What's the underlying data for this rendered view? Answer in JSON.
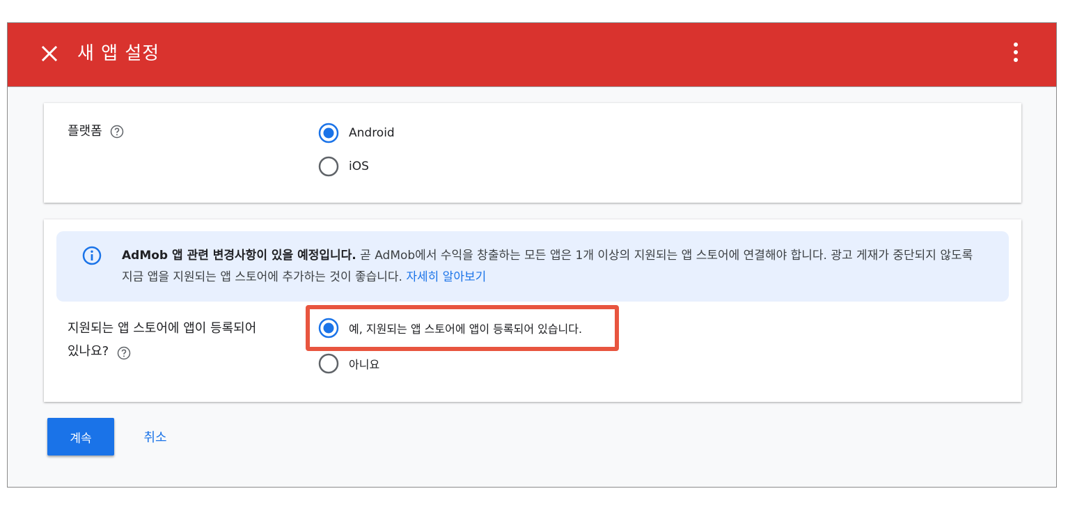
{
  "header": {
    "title": "새 앱 설정",
    "close_icon": "close-icon",
    "more_icon": "more-vert-icon"
  },
  "platform": {
    "label": "플랫폼",
    "options": [
      "Android",
      "iOS"
    ],
    "selected": "Android"
  },
  "notice": {
    "bold": "AdMob 앱 관련 변경사항이 있을 예정입니다.",
    "text": " 곧 AdMob에서 수익을 창출하는 모든 앱은 1개 이상의 지원되는 앱 스토어에 연결해야 합니다. 광고 게재가 중단되지 않도록 지금 앱을 지원되는 앱 스토어에 추가하는 것이 좋습니다. ",
    "link": "자세히 알아보기"
  },
  "store_question": {
    "label_line1": "지원되는 앱 스토어에 앱이 등록되어",
    "label_line2": "있나요?",
    "options": [
      "예, 지원되는 앱 스토어에 앱이 등록되어 있습니다.",
      "아니요"
    ],
    "selected": "예, 지원되는 앱 스토어에 앱이 등록되어 있습니다."
  },
  "actions": {
    "continue": "계속",
    "cancel": "취소"
  },
  "colors": {
    "header": "#d9332e",
    "accent": "#1a73e8",
    "highlight": "#e8553f",
    "info_bg": "#e8f0fe"
  }
}
